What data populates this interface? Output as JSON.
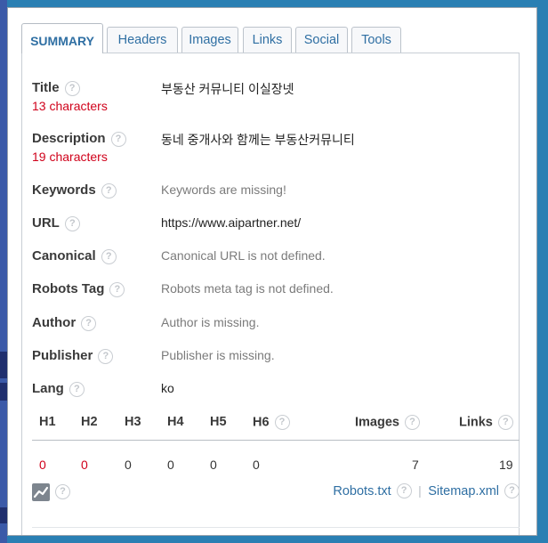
{
  "tabs": [
    {
      "label": "SUMMARY"
    },
    {
      "label": "Headers"
    },
    {
      "label": "Images"
    },
    {
      "label": "Links"
    },
    {
      "label": "Social"
    },
    {
      "label": "Tools"
    }
  ],
  "summary": {
    "title": {
      "label": "Title",
      "value": "부동산 커뮤니티 이실장넷",
      "count": "13 characters"
    },
    "description": {
      "label": "Description",
      "value": "동네 중개사와 함께는 부동산커뮤니티",
      "count": "19 characters"
    },
    "keywords": {
      "label": "Keywords",
      "value": "Keywords are missing!"
    },
    "url": {
      "label": "URL",
      "value": "https://www.aipartner.net/"
    },
    "canonical": {
      "label": "Canonical",
      "value": "Canonical URL is not defined."
    },
    "robots_tag": {
      "label": "Robots Tag",
      "value": "Robots meta tag is not defined."
    },
    "author": {
      "label": "Author",
      "value": "Author is missing."
    },
    "publisher": {
      "label": "Publisher",
      "value": "Publisher is missing."
    },
    "lang": {
      "label": "Lang",
      "value": "ko"
    }
  },
  "stats": {
    "headers": [
      "H1",
      "H2",
      "H3",
      "H4",
      "H5",
      "H6"
    ],
    "header_counts": [
      "0",
      "0",
      "0",
      "0",
      "0",
      "0"
    ],
    "images_label": "Images",
    "images_count": "7",
    "links_label": "Links",
    "links_count": "19"
  },
  "footer": {
    "robots_link": "Robots.txt",
    "separator": "|",
    "sitemap_link": "Sitemap.xml"
  },
  "help_glyph": "?",
  "colors": {
    "link": "#2f6fa3",
    "warning": "#d0021b",
    "muted": "#7b7b7b",
    "frame": "#2a7fb3"
  }
}
